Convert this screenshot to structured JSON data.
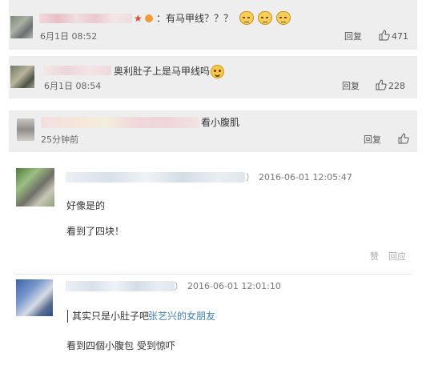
{
  "comments": [
    {
      "text_suffix": "：有马甲线？？？",
      "time": "6月1日 08:52",
      "reply_label": "回复",
      "like_count": "471"
    },
    {
      "text": "奥利肚子上是马甲线吗",
      "time": "6月1日 08:54",
      "reply_label": "回复",
      "like_count": "228"
    },
    {
      "text": "看小腹肌",
      "time": "25分钟前",
      "reply_label": "回复"
    }
  ],
  "threads": [
    {
      "timestamp": "2016-06-01 12:05:47",
      "paren": "）",
      "lines": [
        "好像是的",
        "看到了四块！"
      ],
      "praise_label": "赞",
      "reply_label": "回应"
    },
    {
      "timestamp": "2016-06-01 12:01:10",
      "paren": "）",
      "quote": "其实只是小肚子吧",
      "quote_link": "张艺兴的女朋友",
      "line": "看到四個小腹包 受到惊吓"
    }
  ],
  "colors": {
    "card_bg": "#eeeeee",
    "link": "#3f7fb3",
    "text": "#333333"
  },
  "icons": [
    "thumbs-up-icon",
    "smiley-icon",
    "cat-face-icon",
    "star-icon"
  ]
}
